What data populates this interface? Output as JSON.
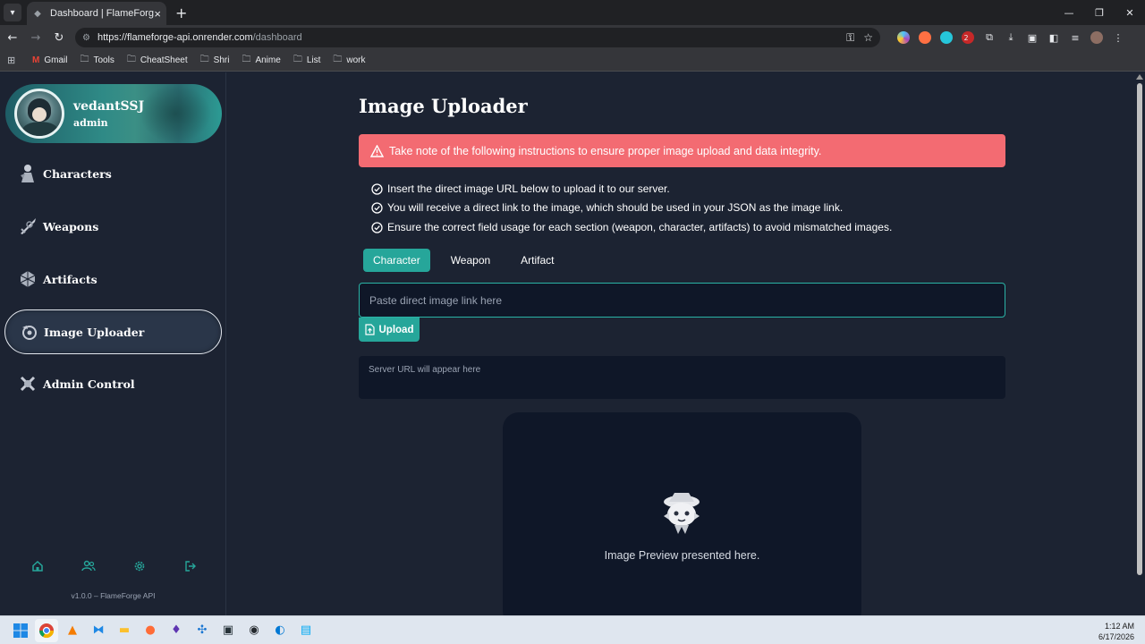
{
  "browser": {
    "tab_title": "Dashboard | FlameForge",
    "url_host": "https://flameforge-api.onrender.com",
    "url_path": "/dashboard",
    "bookmarks": [
      {
        "label": "Gmail",
        "icon": "gmail-icon"
      },
      {
        "label": "Tools",
        "icon": "folder-icon"
      },
      {
        "label": "CheatSheet",
        "icon": "folder-icon"
      },
      {
        "label": "Shri",
        "icon": "folder-icon"
      },
      {
        "label": "Anime",
        "icon": "folder-icon"
      },
      {
        "label": "List",
        "icon": "folder-icon"
      },
      {
        "label": "work",
        "icon": "folder-icon"
      }
    ],
    "extension_badge": "2"
  },
  "sidebar": {
    "profile": {
      "username": "vedantSSJ",
      "role": "admin"
    },
    "items": [
      {
        "label": "Characters",
        "icon": "character-icon"
      },
      {
        "label": "Weapons",
        "icon": "sword-icon"
      },
      {
        "label": "Artifacts",
        "icon": "artifact-icon"
      },
      {
        "label": "Image Uploader",
        "icon": "uploader-icon"
      },
      {
        "label": "Admin Control",
        "icon": "admin-icon"
      }
    ],
    "bottom_icons": [
      "home-icon",
      "users-icon",
      "gear-icon",
      "logout-icon"
    ],
    "version": "v1.0.0 – FlameForge API"
  },
  "main": {
    "title": "Image Uploader",
    "alert": "Take note of the following instructions to ensure proper image upload and data integrity.",
    "instructions": [
      "Insert the direct image URL below to upload it to our server.",
      "You will receive a direct link to the image, which should be used in your JSON as the image link.",
      "Ensure the correct field usage for each section (weapon, character, artifacts) to avoid mismatched images."
    ],
    "tabs": [
      "Character",
      "Weapon",
      "Artifact"
    ],
    "active_tab": "Character",
    "input_placeholder": "Paste direct image link here",
    "input_value": "",
    "upload_label": "Upload",
    "server_url_placeholder": "Server URL will appear here",
    "preview_text": "Image Preview presented here."
  },
  "taskbar": {
    "time": "1:12 AM",
    "date": "6/17/2026"
  },
  "colors": {
    "accent": "#26a69a",
    "alert": "#f36b72",
    "background": "#1c2332",
    "panel": "#0f1728"
  }
}
